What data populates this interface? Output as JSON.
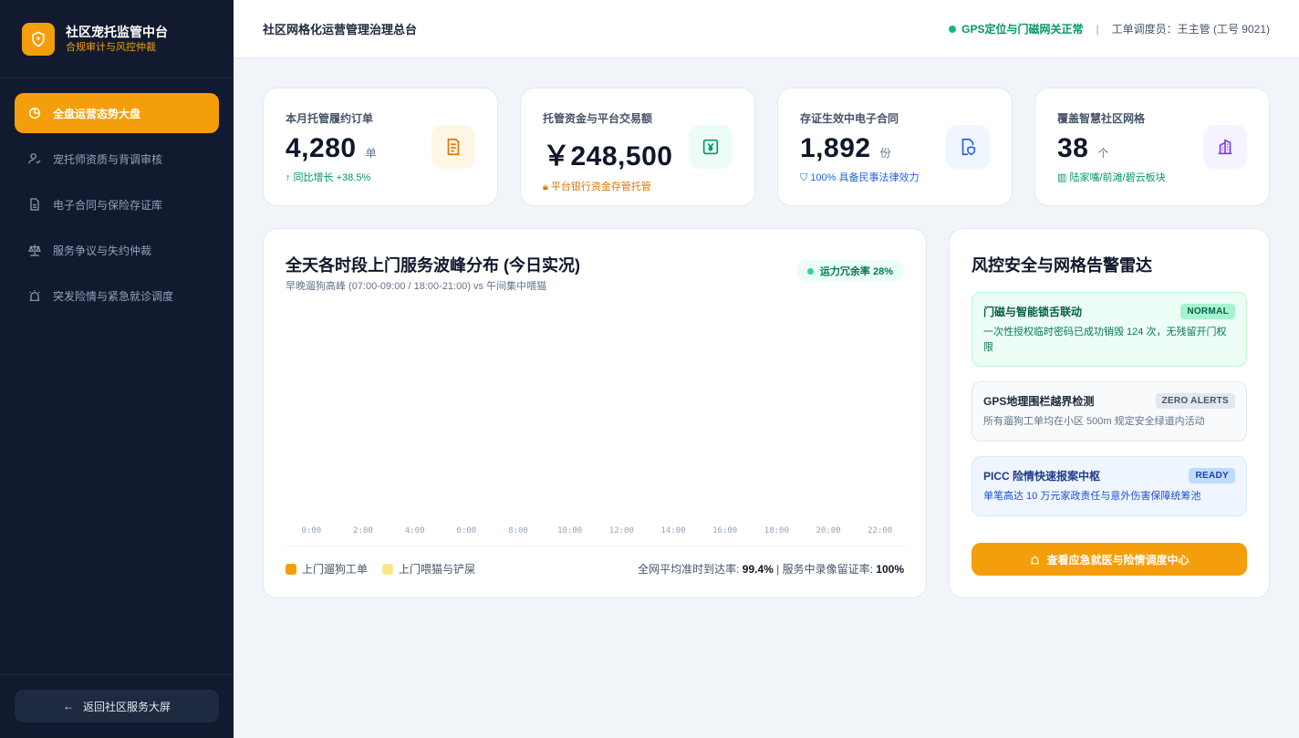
{
  "brand": {
    "title": "社区宠托监管中台",
    "subtitle": "合规审计与风控仲裁"
  },
  "sidebar": {
    "items": [
      {
        "label": "全盘运营态势大盘",
        "icon": "pie-chart-icon",
        "active": true
      },
      {
        "label": "宠托师资质与背调审核",
        "icon": "user-check-icon"
      },
      {
        "label": "电子合同与保险存证库",
        "icon": "document-icon"
      },
      {
        "label": "服务争议与失约仲裁",
        "icon": "scale-icon"
      },
      {
        "label": "突发险情与紧急就诊调度",
        "icon": "siren-icon"
      }
    ],
    "back_label": "返回社区服务大屏"
  },
  "header": {
    "title": "社区网格化运营管理治理总台",
    "status": "GPS定位与门磁网关正常",
    "dispatcher": "工单调度员：王主管 (工号 9021)"
  },
  "stats": [
    {
      "label": "本月托管履约订单",
      "value": "4,280",
      "unit": "单",
      "note": "↑ 同比增长 +38.5%",
      "note_color": "#059669",
      "icon": "receipt-icon",
      "icon_bg": "#fff7e6",
      "icon_color": "#d97706"
    },
    {
      "label": "托管资金与平台交易额",
      "value": "￥248,500",
      "unit": "",
      "note": "平台银行资金存管托管",
      "note_color": "#d97706",
      "icon": "yuan-note-icon",
      "icon_bg": "#ecfdf5",
      "icon_color": "#059669"
    },
    {
      "label": "存证生效中电子合同",
      "value": "1,892",
      "unit": "份",
      "note": "100% 具备民事法律效力",
      "note_color": "#2563eb",
      "icon": "file-shield-icon",
      "icon_bg": "#eff6ff",
      "icon_color": "#2563eb"
    },
    {
      "label": "覆盖智慧社区网格",
      "value": "38",
      "unit": "个",
      "note": "陆家嘴/前滩/碧云板块",
      "note_color": "#059669",
      "icon": "building-icon",
      "icon_bg": "#f5f3ff",
      "icon_color": "#7c3aed"
    }
  ],
  "chart": {
    "title": "全天各时段上门服务波峰分布 (今日实况)",
    "subtitle": "早晚遛狗高峰 (07:00-09:00 / 18:00-21:00) vs 午间集中喂猫",
    "chip": "运力冗余率 28%",
    "legend": [
      {
        "name": "上门遛狗工单",
        "color": "#f59e0b"
      },
      {
        "name": "上门喂猫与铲屎",
        "color": "#fde68a"
      }
    ],
    "foot_prefix": "全网平均准时到达率: ",
    "foot_rate": "99.4%",
    "foot_mid": " | 服务中录像留证率: ",
    "foot_video": "100%"
  },
  "chart_data": {
    "type": "bar",
    "categories": [
      "0:00",
      "2:00",
      "4:00",
      "6:00",
      "8:00",
      "10:00",
      "12:00",
      "14:00",
      "16:00",
      "18:00",
      "20:00",
      "22:00"
    ],
    "series": [
      {
        "name": "上门遛狗工单",
        "values": []
      },
      {
        "name": "上门喂猫与铲屎",
        "values": []
      }
    ]
  },
  "risk": {
    "title": "风控安全与网格告警雷达",
    "alerts": [
      {
        "title": "门磁与智能锁舌联动",
        "badge": "NORMAL",
        "desc": "一次性授权临时密码已成功销毁 124 次，无残留开门权限"
      },
      {
        "title": "GPS地理围栏越界检测",
        "badge": "ZERO ALERTS",
        "desc": "所有遛狗工单均在小区 500m 规定安全绿道内活动"
      },
      {
        "title": "PICC 险情快速报案中枢",
        "badge": "READY",
        "desc": "单笔高达 10 万元家政责任与意外伤害保障统筹池"
      }
    ],
    "cta": "查看应急就医与险情调度中心"
  }
}
